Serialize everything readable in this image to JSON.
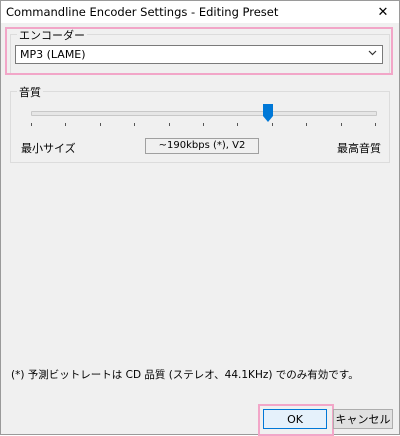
{
  "window": {
    "title": "Commandline Encoder Settings - Editing Preset",
    "close_glyph": "✕"
  },
  "encoder": {
    "label": "エンコーダー",
    "selected": "MP3 (LAME)"
  },
  "quality": {
    "label": "音質",
    "min_label": "最小サイズ",
    "max_label": "最高音質",
    "bitrate_text": "~190kbps (*), V2",
    "slider_position": 0.69
  },
  "footnote": "(*) 予測ビットレートは CD 品質 (ステレオ、44.1KHz) でのみ有効です。",
  "buttons": {
    "ok": "OK",
    "cancel": "キャンセル"
  },
  "colors": {
    "accent": "#0078d7",
    "highlight": "#f2a6c8"
  }
}
